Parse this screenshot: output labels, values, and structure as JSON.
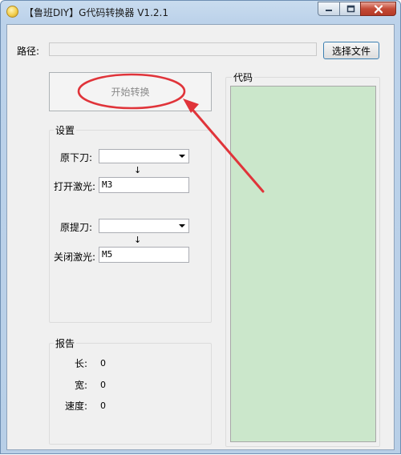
{
  "window": {
    "title": "【鲁班DIY】G代码转换器 V1.2.1"
  },
  "path": {
    "label": "路径:",
    "value": "",
    "choose_button": "选择文件"
  },
  "start_button": "开始转换",
  "settings": {
    "title": "设置",
    "orig_down_label": "原下刀:",
    "orig_down_value": "",
    "laser_on_label": "打开激光:",
    "laser_on_value": "M3",
    "orig_up_label": "原提刀:",
    "orig_up_value": "",
    "laser_off_label": "关闭激光:",
    "laser_off_value": "M5",
    "arrow": "↓"
  },
  "report": {
    "title": "报告",
    "length_label": "长:",
    "length_value": "0",
    "width_label": "宽:",
    "width_value": "0",
    "speed_label": "速度:",
    "speed_value": "0"
  },
  "code": {
    "title": "代码",
    "content": ""
  },
  "annotation": {
    "color": "#e0343a"
  }
}
